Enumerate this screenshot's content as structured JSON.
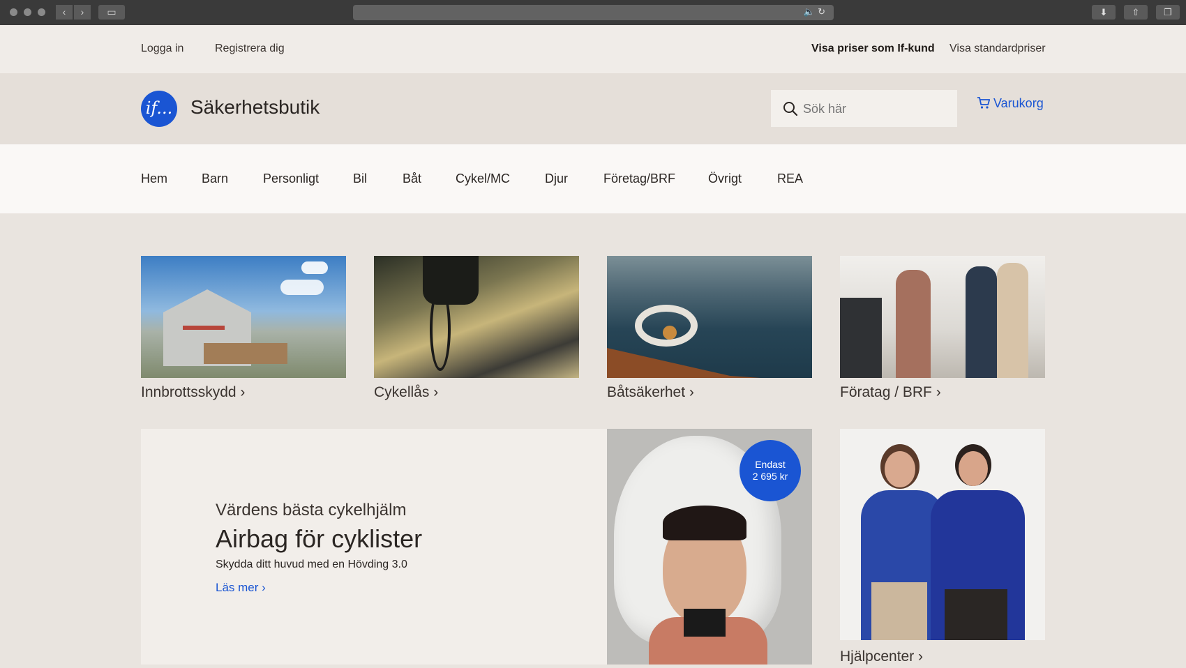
{
  "utility": {
    "login": "Logga in",
    "register": "Registrera dig",
    "if_prices": "Visa priser som If-kund",
    "standard_prices": "Visa standardpriser"
  },
  "header": {
    "logo_text": "if...",
    "brand": "Säkerhetsbutik",
    "search_placeholder": "Sök här",
    "cart": "Varukorg"
  },
  "nav": [
    "Hem",
    "Barn",
    "Personligt",
    "Bil",
    "Båt",
    "Cykel/MC",
    "Djur",
    "Företag/BRF",
    "Övrigt",
    "REA"
  ],
  "cards": [
    {
      "label": "Innbrottsskydd ›"
    },
    {
      "label": "Cykellås ›"
    },
    {
      "label": "Båtsäkerhet ›"
    },
    {
      "label": "Föratag / BRF ›"
    }
  ],
  "promo": {
    "subtitle": "Värdens bästa cykelhjälm",
    "title": "Airbag för cyklister",
    "description": "Skydda ditt huvud med en Hövding 3.0",
    "link": "Läs mer ›",
    "badge_line1": "Endast",
    "badge_line2": "2 695 kr"
  },
  "help": {
    "label": "Hjälpcenter ›"
  },
  "colors": {
    "brand_blue": "#1a55d3",
    "page_bg": "#e9e4df"
  }
}
